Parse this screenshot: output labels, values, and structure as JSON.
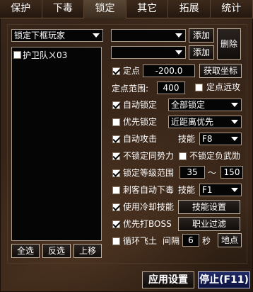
{
  "tabs": [
    {
      "label": "保护"
    },
    {
      "label": "下毒"
    },
    {
      "label": "锁定"
    },
    {
      "label": "其它"
    },
    {
      "label": "拓展"
    },
    {
      "label": "统计"
    }
  ],
  "left": {
    "target_select": "锁定下框玩家",
    "list_items": [
      {
        "label": "护卫队ㄨ03",
        "checked": false
      }
    ],
    "buttons": {
      "select_all": "全选",
      "invert": "反选",
      "move_up": "上移"
    }
  },
  "right": {
    "add1": "添加",
    "add2": "添加",
    "delete": "删除",
    "fixed_point": {
      "label": "定点",
      "checked": true,
      "value": "-200.0",
      "get_coords": "获取坐标"
    },
    "range": {
      "label": "定点范围:",
      "value": "400",
      "far_label": "定点远攻",
      "far_checked": false
    },
    "auto_lock": {
      "label": "自动锁定",
      "checked": true,
      "option": "全部锁定"
    },
    "priority_lock": {
      "label": "优先锁定",
      "checked": false,
      "option": "近距离优先"
    },
    "auto_attack": {
      "label": "自动攻击",
      "checked": true,
      "skill_label": "技能",
      "skill_key": "F8"
    },
    "no_lock_same": {
      "label": "不锁定同势力",
      "checked": true
    },
    "no_lock_negative": {
      "label": "不锁定负武勋",
      "checked": false
    },
    "level_range": {
      "label": "锁定等级范围",
      "checked": true,
      "min": "35",
      "tilde": "～",
      "max": "150"
    },
    "assassin": {
      "label": "刺客自动下毒",
      "checked": false,
      "skill_label": "技能",
      "skill_key": "F1"
    },
    "cooldown": {
      "label": "使用冷却技能",
      "checked": true,
      "button": "技能设置"
    },
    "boss": {
      "label": "优先打BOSS",
      "checked": true,
      "button": "职业过滤"
    },
    "cycle": {
      "label": "循环飞土",
      "checked": false,
      "interval_label": "间隔",
      "interval": "6",
      "unit": "秒",
      "button": "地点"
    }
  },
  "footer": {
    "apply": "应用设置",
    "stop": "停止(F11)"
  }
}
